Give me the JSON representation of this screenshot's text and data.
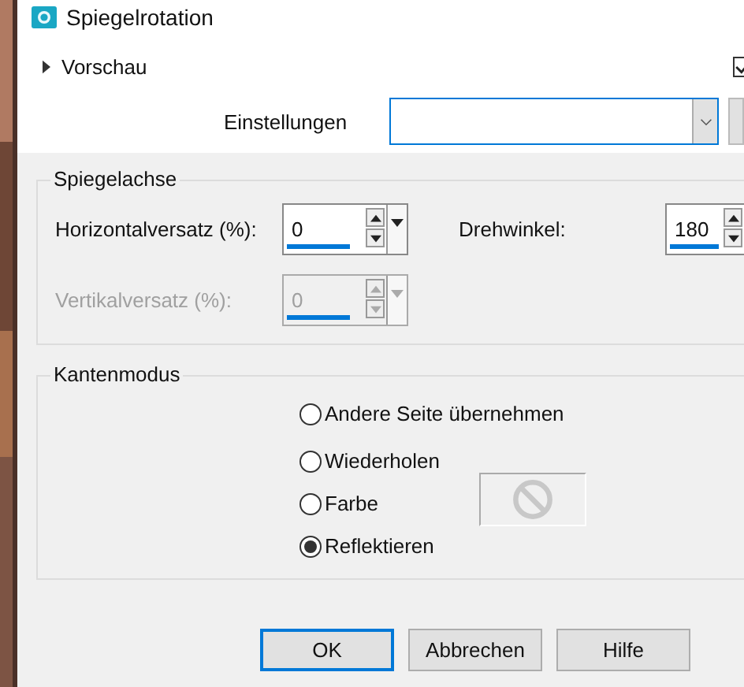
{
  "window": {
    "title": "Spiegelrotation"
  },
  "preview": {
    "label": "Vorschau",
    "expanded": false,
    "checked": true
  },
  "settings": {
    "label": "Einstellungen"
  },
  "mirror_axis": {
    "title": "Spiegelachse",
    "fields": [
      {
        "label": "Horizontalversatz (%):",
        "value": "0",
        "disabled": false
      },
      {
        "label": "Drehwinkel:",
        "value": "180",
        "disabled": false
      },
      {
        "label": "Vertikalversatz (%):",
        "value": "0",
        "disabled": true
      }
    ]
  },
  "edge_mode": {
    "title": "Kantenmodus",
    "options": [
      {
        "label": "Andere Seite übernehmen",
        "selected": false
      },
      {
        "label": "Wiederholen",
        "selected": false
      },
      {
        "label": "Farbe",
        "selected": false
      },
      {
        "label": "Reflektieren",
        "selected": true
      }
    ]
  },
  "buttons": [
    {
      "label": "OK",
      "default": true
    },
    {
      "label": "Abbrechen",
      "default": false
    },
    {
      "label": "Hilfe",
      "default": false
    }
  ]
}
